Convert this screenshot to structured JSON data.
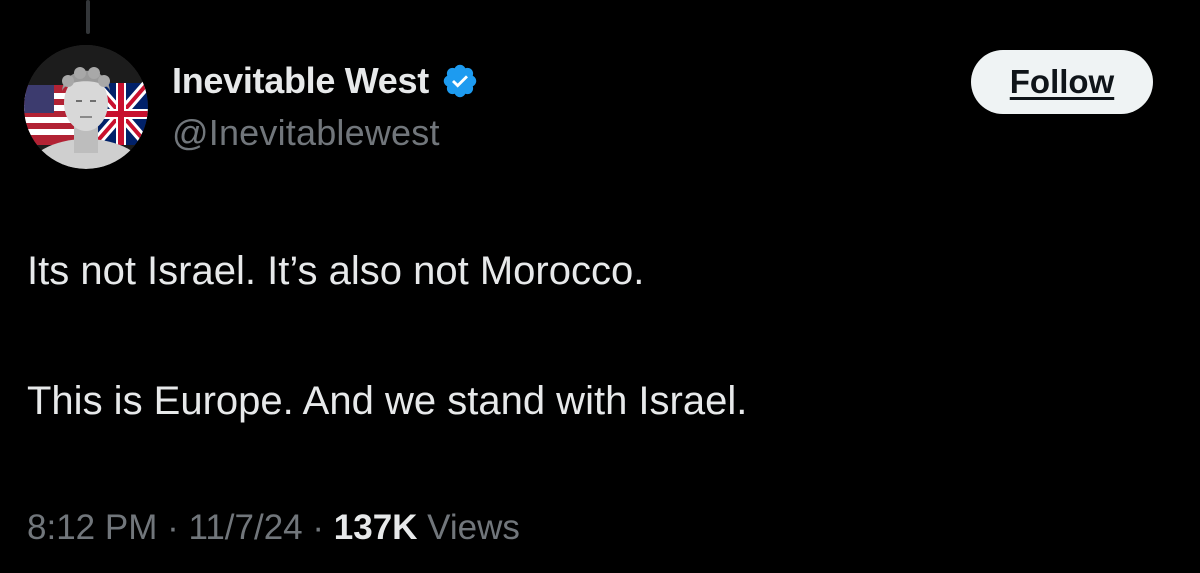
{
  "author": {
    "display_name": "Inevitable West",
    "handle": "@Inevitablewest",
    "avatar_icon": "statue-with-flags-avatar",
    "verified_icon": "verified-badge-icon",
    "verified_color": "#1d9bf0"
  },
  "follow_button": {
    "label": "Follow"
  },
  "tweet": {
    "paragraphs": [
      "Its not Israel. It’s also not Morocco.",
      "This is Europe. And we stand with Israel."
    ]
  },
  "meta": {
    "time": "8:12 PM",
    "separator1": " · ",
    "date": "11/7/24",
    "separator2": " · ",
    "views_count": "137K",
    "views_label": " Views"
  },
  "colors": {
    "background": "#000000",
    "text_primary": "#e7e9ea",
    "text_secondary": "#71767b",
    "button_bg": "#eff3f4"
  }
}
